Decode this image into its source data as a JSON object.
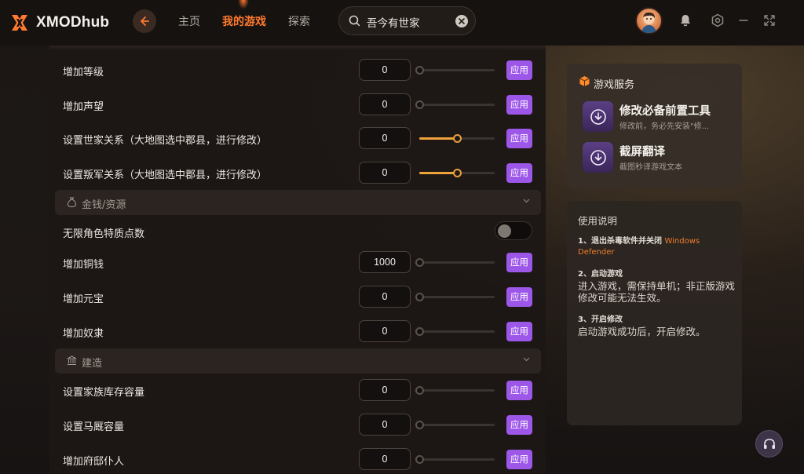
{
  "app": {
    "name": "XMODhub",
    "brand_color": "#ff7a2f",
    "accent_purple": "#9d57e8"
  },
  "nav": {
    "home": "主页",
    "my_games": "我的游戏",
    "explore": "探索",
    "active": "my_games"
  },
  "search": {
    "value": "吾今有世家"
  },
  "icons": {
    "back": "arrow-left-icon",
    "search": "search-icon",
    "clear": "clear-icon",
    "notification": "bell-icon",
    "settings": "settings-icon",
    "minimize": "minimize-icon",
    "fullscreen": "fullscreen-icon",
    "support": "headset-icon"
  },
  "main": {
    "apply_label": "应用",
    "rows_top": [
      {
        "label": "增加等级",
        "value": "0",
        "slider": 0
      },
      {
        "label": "增加声望",
        "value": "0",
        "slider": 0
      },
      {
        "label": "设置世家关系（大地图选中郡县，进行修改）",
        "value": "0",
        "slider": 0.5
      },
      {
        "label": "设置叛军关系（大地图选中郡县，进行修改）",
        "value": "0",
        "slider": 0.5
      }
    ],
    "section_money": {
      "label": "金钱/资源",
      "toggle_row": {
        "label": "无限角色特质点数",
        "on": false
      },
      "rows": [
        {
          "label": "增加铜钱",
          "value": "1000",
          "slider": 0
        },
        {
          "label": "增加元宝",
          "value": "0",
          "slider": 0
        },
        {
          "label": "增加奴隶",
          "value": "0",
          "slider": 0
        }
      ]
    },
    "section_build": {
      "label": "建造",
      "rows": [
        {
          "label": "设置家族库存容量",
          "value": "0",
          "slider": 0
        },
        {
          "label": "设置马厩容量",
          "value": "0",
          "slider": 0
        },
        {
          "label": "增加府邸仆人",
          "value": "0",
          "slider": 0
        }
      ]
    }
  },
  "service": {
    "title": "游戏服务",
    "items": [
      {
        "name": "修改必备前置工具",
        "desc": "修改前，务必先安装\"修..."
      },
      {
        "name": "截屏翻译",
        "desc": "截图秒译游戏文本"
      }
    ]
  },
  "help": {
    "title": "使用说明",
    "steps": [
      {
        "title": "1、退出杀毒软件并关闭",
        "title_highlight": "Windows Defender",
        "body": ""
      },
      {
        "title": "2、启动游戏",
        "title_highlight": "",
        "body": "进入游戏，需保持单机；非正版游戏修改可能无法生效。"
      },
      {
        "title": "3、开启修改",
        "title_highlight": "",
        "body": "启动游戏成功后，开启修改。"
      }
    ]
  }
}
